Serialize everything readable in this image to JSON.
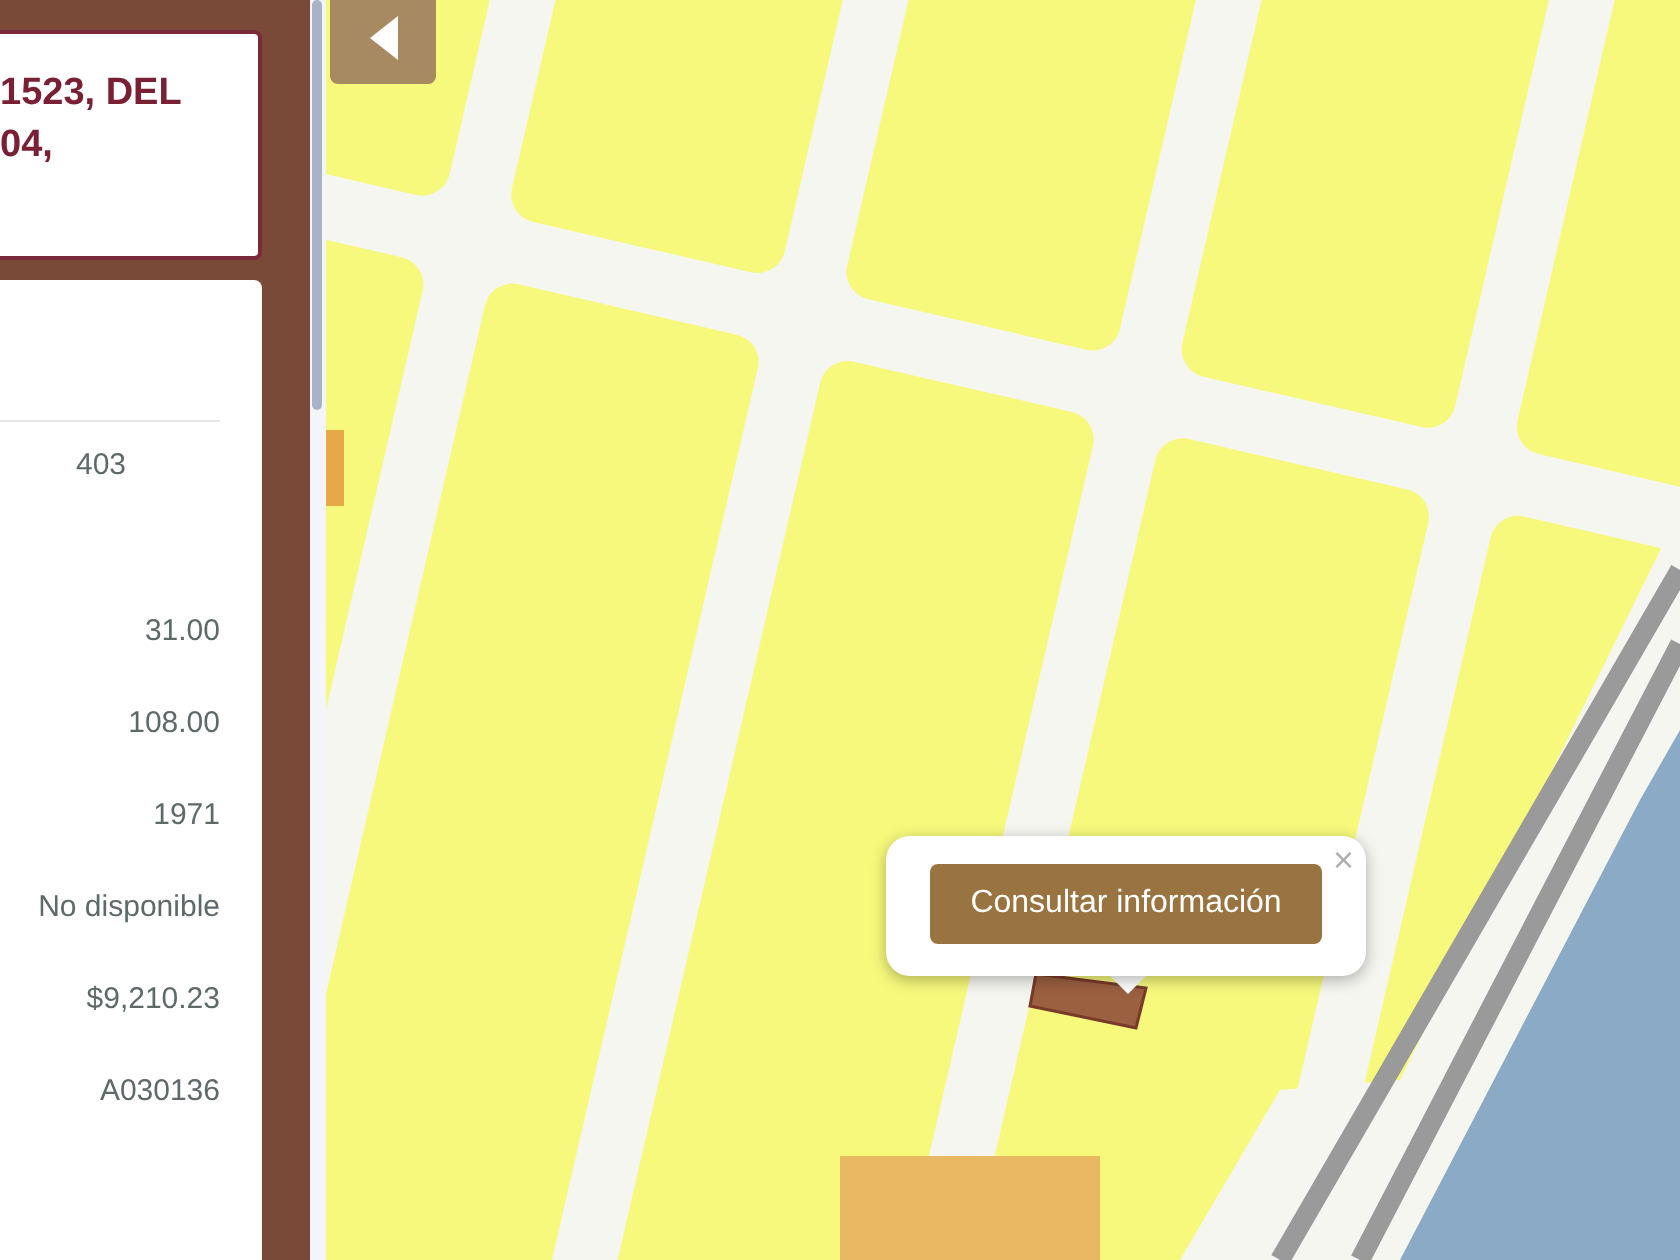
{
  "panel": {
    "title_lines": [
      "1523, DEL",
      "04,"
    ],
    "rows": [
      {
        "kind": "inline",
        "value": "403"
      },
      {
        "kind": "value",
        "value": "31.00"
      },
      {
        "kind": "value",
        "value": "108.00"
      },
      {
        "kind": "value",
        "value": "1971"
      },
      {
        "kind": "spaced",
        "value": "No disponible"
      },
      {
        "kind": "value",
        "value": "$9,210.23"
      },
      {
        "kind": "value",
        "value": "A030136"
      }
    ]
  },
  "map": {
    "popup": {
      "button": "Consultar información",
      "close": "×"
    }
  }
}
